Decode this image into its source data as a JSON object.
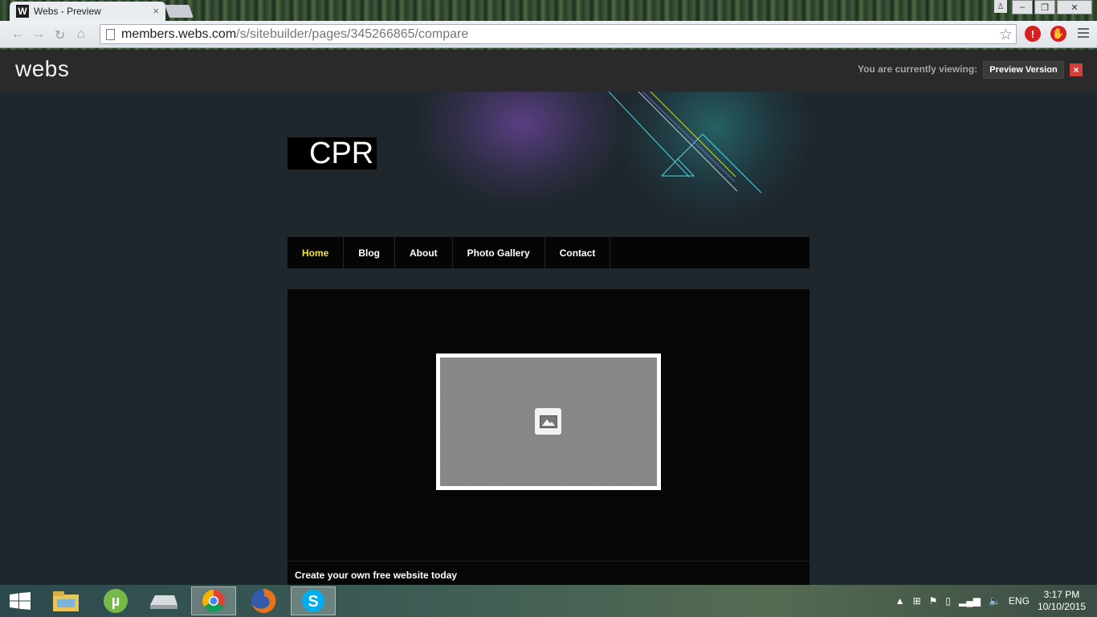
{
  "browser": {
    "tab_title": "Webs - Preview",
    "tab_favicon": "W",
    "tab_close": "×",
    "url_host": "members.webs.com",
    "url_path": "/s/sitebuilder/pages/345266865/compare"
  },
  "preview_bar": {
    "logo": "webs",
    "viewing_label": "You are currently viewing:",
    "preview_button": "Preview Version",
    "close": "×"
  },
  "site": {
    "title": "CPR",
    "nav": [
      {
        "label": "Home",
        "active": true
      },
      {
        "label": "Blog",
        "active": false
      },
      {
        "label": "About",
        "active": false
      },
      {
        "label": "Photo Gallery",
        "active": false
      },
      {
        "label": "Contact",
        "active": false
      }
    ],
    "footer_text": "Create your own free website today",
    "accent_color": "#f3e524"
  },
  "taskbar": {
    "apps": [
      "file-explorer-icon",
      "utorrent-icon",
      "drive-icon",
      "chrome-icon",
      "firefox-icon",
      "skype-icon"
    ],
    "language": "ENG",
    "time": "3:17 PM",
    "date": "10/10/2015"
  }
}
